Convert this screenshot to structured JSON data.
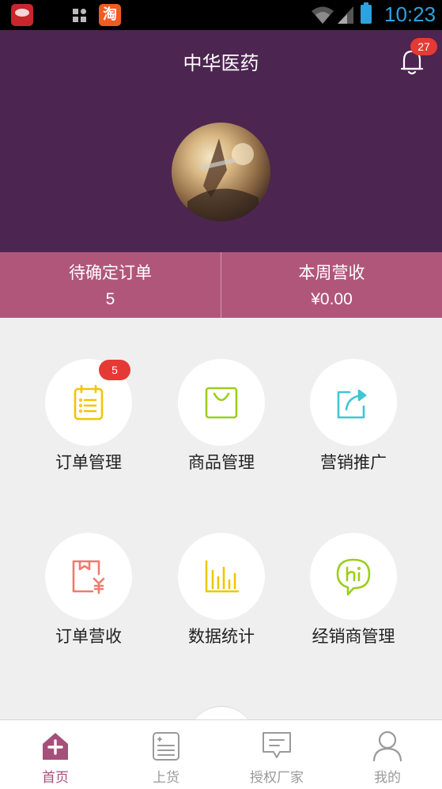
{
  "status_bar": {
    "time": "10:23",
    "apps": [
      {
        "icon": "jd-app-icon"
      },
      {
        "icon": "grid-icon"
      },
      {
        "icon": "taobao-app-icon",
        "glyph": "淘"
      }
    ]
  },
  "header": {
    "title": "中华医药",
    "notification_count": "27",
    "avatar": "avatar"
  },
  "summary": {
    "pending_label": "待确定订单",
    "pending_value": "5",
    "revenue_label": "本周营收",
    "revenue_value": "¥0.00"
  },
  "menu": {
    "items": [
      {
        "label": "订单管理",
        "badge": "5",
        "icon": "clipboard-icon",
        "color": "#f2c500"
      },
      {
        "label": "商品管理",
        "icon": "shopping-bag-icon",
        "color": "#9bcf1a"
      },
      {
        "label": "营销推广",
        "icon": "share-icon",
        "color": "#3fc6d4"
      },
      {
        "label": "订单营收",
        "icon": "revenue-icon",
        "color": "#f27a6b"
      },
      {
        "label": "数据统计",
        "icon": "bar-chart-icon",
        "color": "#f2c500"
      },
      {
        "label": "经销商管理",
        "icon": "hi-chat-icon",
        "color": "#9bcf1a"
      }
    ]
  },
  "bottom_nav": {
    "items": [
      {
        "label": "首页",
        "icon": "home-icon",
        "active": true
      },
      {
        "label": "上货",
        "icon": "stock-list-icon"
      },
      {
        "label": "授权厂家",
        "icon": "message-icon"
      },
      {
        "label": "我的",
        "icon": "profile-icon"
      }
    ]
  },
  "colors": {
    "header_bg": "#4c2550",
    "summary_bg": "#b1567b",
    "badge": "#e53935",
    "nav_active": "#a5507a",
    "nav_inactive": "#9a9a9a",
    "status_accent": "#2ea1df"
  }
}
